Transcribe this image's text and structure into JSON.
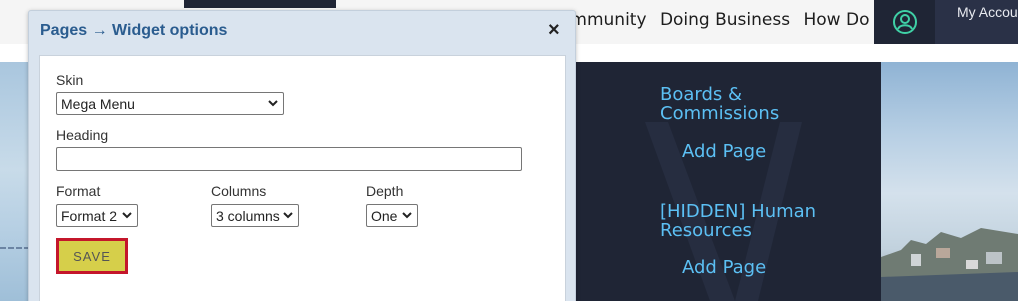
{
  "site": {
    "nav_items": [
      "ommunity",
      "Doing Business",
      "How Do"
    ],
    "account_label": "My Accou",
    "panel_items": [
      {
        "heading": "Boards & Commissions",
        "action": "Add Page"
      },
      {
        "heading": "[HIDDEN] Human Resources",
        "action": "Add Page"
      }
    ]
  },
  "dialog": {
    "title": "Pages → Widget options",
    "close_symbol": "×",
    "skin": {
      "label": "Skin",
      "value": "Mega Menu"
    },
    "heading": {
      "label": "Heading",
      "value": ""
    },
    "format": {
      "label": "Format",
      "value": "Format 2"
    },
    "columns": {
      "label": "Columns",
      "value": "3 columns"
    },
    "depth": {
      "label": "Depth",
      "value": "One"
    },
    "save_label": "SAVE"
  },
  "colors": {
    "dialog_bg": "#dae4ef",
    "dialog_title": "#2a5c8f",
    "dark_panel": "#1f2535",
    "link_blue": "#5cc0f4",
    "save_bg": "#d6cf4a",
    "save_border": "#c4162b",
    "account_icon": "#3fd0a6"
  },
  "icons": {
    "account": "user-circle-icon",
    "close": "close-icon",
    "select": "chevron-down-icon"
  }
}
